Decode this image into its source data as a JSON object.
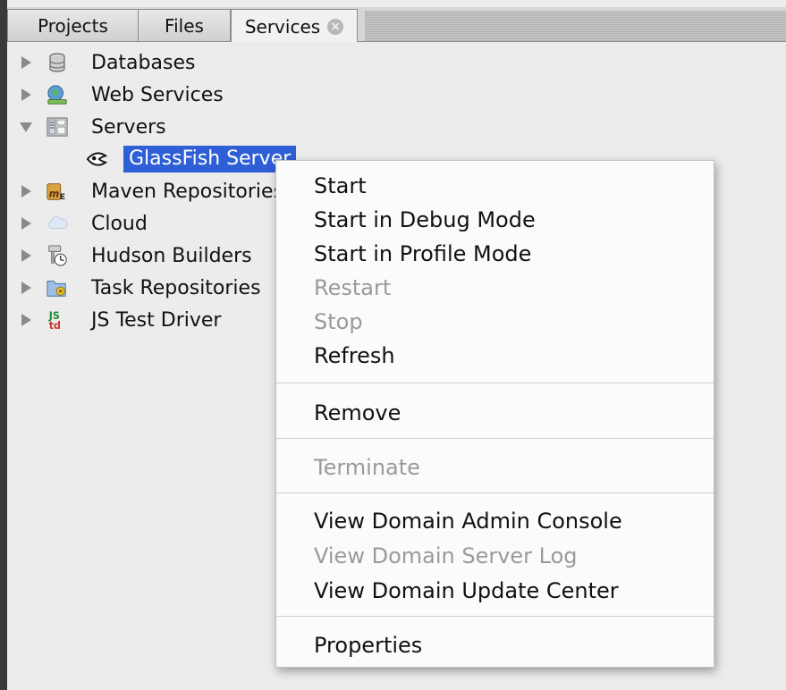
{
  "tabs": [
    {
      "label": "Projects"
    },
    {
      "label": "Files"
    },
    {
      "label": "Services"
    }
  ],
  "tree": {
    "items": [
      {
        "label": "Databases",
        "icon": "database-icon",
        "expanded": false
      },
      {
        "label": "Web Services",
        "icon": "web-services-icon",
        "expanded": false
      },
      {
        "label": "Servers",
        "icon": "servers-icon",
        "expanded": true
      },
      {
        "label": "GlassFish Server",
        "icon": "glassfish-icon",
        "selected": true
      },
      {
        "label": "Maven Repositories",
        "icon": "maven-icon",
        "expanded": false
      },
      {
        "label": "Cloud",
        "icon": "cloud-icon",
        "expanded": false
      },
      {
        "label": "Hudson Builders",
        "icon": "hudson-icon",
        "expanded": false
      },
      {
        "label": "Task Repositories",
        "icon": "task-repository-icon",
        "expanded": false
      },
      {
        "label": "JS Test Driver",
        "icon": "js-test-driver-icon",
        "expanded": false
      }
    ]
  },
  "context_menu": {
    "items": [
      {
        "label": "Start",
        "enabled": true
      },
      {
        "label": "Start in Debug Mode",
        "enabled": true
      },
      {
        "label": "Start in Profile Mode",
        "enabled": true
      },
      {
        "label": "Restart",
        "enabled": false
      },
      {
        "label": "Stop",
        "enabled": false
      },
      {
        "label": "Refresh",
        "enabled": true
      },
      {
        "label": "Remove",
        "enabled": true
      },
      {
        "label": "Terminate",
        "enabled": false
      },
      {
        "label": "View Domain Admin Console",
        "enabled": true
      },
      {
        "label": "View Domain Server Log",
        "enabled": false
      },
      {
        "label": "View Domain Update Center",
        "enabled": true
      },
      {
        "label": "Properties",
        "enabled": true
      }
    ]
  },
  "colors": {
    "selection": "#2f5fd6",
    "disabled_text": "#9a9a9a"
  }
}
